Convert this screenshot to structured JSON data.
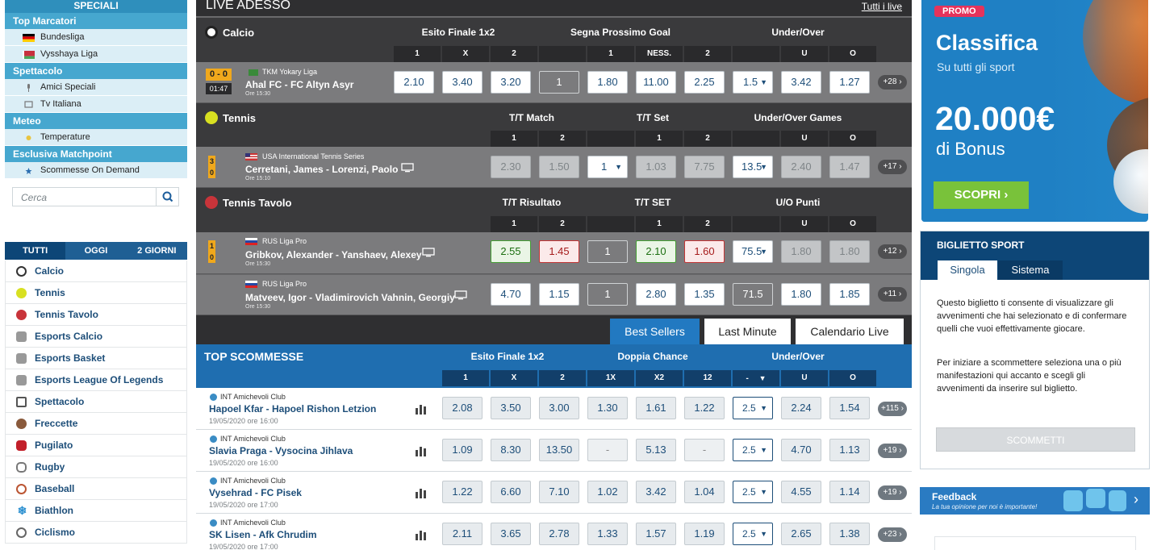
{
  "left": {
    "speciali": "SPECIALI",
    "cats": [
      {
        "label": "Top Marcatori",
        "subs": [
          "Bundesliga",
          "Vysshaya Liga"
        ]
      },
      {
        "label": "Spettacolo",
        "subs": [
          "Amici Speciali",
          "Tv Italiana"
        ]
      },
      {
        "label": "Meteo",
        "subs": [
          "Temperature"
        ]
      },
      {
        "label": "Esclusiva Matchpoint",
        "subs": [
          "Scommesse On Demand"
        ]
      }
    ],
    "search_placeholder": "Cerca",
    "tabs": [
      "TUTTI",
      "OGGI",
      "2 GIORNI"
    ],
    "sports": [
      "Calcio",
      "Tennis",
      "Tennis Tavolo",
      "Esports Calcio",
      "Esports Basket",
      "Esports League Of Legends",
      "Spettacolo",
      "Freccette",
      "Pugilato",
      "Rugby",
      "Baseball",
      "Biathlon",
      "Ciclismo"
    ]
  },
  "live": {
    "title": "LIVE ADESSO",
    "all_link": "Tutti i live",
    "calcio": {
      "name": "Calcio",
      "groups": [
        "Esito Finale 1x2",
        "Segna Prossimo Goal",
        "Under/Over"
      ],
      "cols": [
        "1",
        "X",
        "2",
        "1",
        "NESS.",
        "2",
        "U",
        "O"
      ],
      "match": {
        "score": "0 - 0",
        "clock": "01:47",
        "league": "TKM Yokary Liga",
        "teams": "Ahal FC - FC Altyn Asyr",
        "time": "Ore 15:30",
        "odds": [
          "2.10",
          "3.40",
          "3.20",
          "1",
          "1.80",
          "11.00",
          "2.25",
          "1.5",
          "3.42",
          "1.27"
        ],
        "more": "+28"
      }
    },
    "tennis": {
      "name": "Tennis",
      "groups": [
        "T/T Match",
        "T/T Set",
        "Under/Over Games"
      ],
      "cols": [
        "1",
        "2",
        "1",
        "2",
        "U",
        "O"
      ],
      "match": {
        "s1": "3",
        "s2": "0",
        "league": "USA International Tennis Series",
        "teams": "Cerretani, James - Lorenzi, Paolo",
        "time": "Ore 15:10",
        "odds": [
          "2.30",
          "1.50",
          "1",
          "1.03",
          "7.75",
          "13.5",
          "2.40",
          "1.47"
        ],
        "more": "+17"
      }
    },
    "tavolo": {
      "name": "Tennis Tavolo",
      "groups": [
        "T/T Risultato",
        "T/T SET",
        "U/O Punti"
      ],
      "cols": [
        "1",
        "2",
        "1",
        "2",
        "U",
        "O"
      ],
      "matches": [
        {
          "s1": "1",
          "s2": "0",
          "league": "RUS Liga Pro",
          "teams": "Gribkov, Alexander - Yanshaev, Alexey",
          "time": "Ore 15:30",
          "odds": [
            "2.55",
            "1.45",
            "1",
            "2.10",
            "1.60",
            "75.5",
            "1.80",
            "1.80"
          ],
          "more": "+12"
        },
        {
          "league": "RUS Liga Pro",
          "teams": "Matveev, Igor - Vladimirovich Vahnin, Georgiy",
          "time": "Ore 15:30",
          "odds": [
            "4.70",
            "1.15",
            "1",
            "2.80",
            "1.35",
            "71.5",
            "1.80",
            "1.85"
          ],
          "more": "+11"
        }
      ]
    }
  },
  "tabs": [
    "Best Sellers",
    "Last Minute",
    "Calendario Live"
  ],
  "top": {
    "title": "TOP SCOMMESSE",
    "groups": [
      "Esito Finale 1x2",
      "Doppia Chance",
      "Under/Over"
    ],
    "cols": [
      "1",
      "X",
      "2",
      "1X",
      "X2",
      "12",
      "-",
      "U",
      "O"
    ],
    "rows": [
      {
        "league": "INT Amichevoli Club",
        "teams": "Hapoel Kfar - Hapoel Rishon Letzion",
        "time": "19/05/2020 ore 16:00",
        "odds": [
          "2.08",
          "3.50",
          "3.00",
          "1.30",
          "1.61",
          "1.22",
          "2.5",
          "2.24",
          "1.54"
        ],
        "more": "+115"
      },
      {
        "league": "INT Amichevoli Club",
        "teams": "Slavia Praga - Vysocina Jihlava",
        "time": "19/05/2020 ore 16:00",
        "odds": [
          "1.09",
          "8.30",
          "13.50",
          "-",
          "5.13",
          "-",
          "2.5",
          "4.70",
          "1.13"
        ],
        "more": "+19"
      },
      {
        "league": "INT Amichevoli Club",
        "teams": "Vysehrad - FC Pisek",
        "time": "19/05/2020 ore 17:00",
        "odds": [
          "1.22",
          "6.60",
          "7.10",
          "1.02",
          "3.42",
          "1.04",
          "2.5",
          "4.55",
          "1.14"
        ],
        "more": "+19"
      },
      {
        "league": "INT Amichevoli Club",
        "teams": "SK Lisen - Afk Chrudim",
        "time": "19/05/2020 ore 17:00",
        "odds": [
          "2.11",
          "3.65",
          "2.78",
          "1.33",
          "1.57",
          "1.19",
          "2.5",
          "2.65",
          "1.38"
        ],
        "more": "+23"
      }
    ]
  },
  "promo": {
    "badge": "PROMO",
    "title": "Classifica",
    "subtitle": "Su tutti gli sport",
    "amount": "20.000€",
    "bonus": "di Bonus",
    "cta": "SCOPRI"
  },
  "slip": {
    "title": "BIGLIETTO SPORT",
    "tabs": [
      "Singola",
      "Sistema"
    ],
    "p1": "Questo biglietto ti consente di visualizzare gli avvenimenti che hai selezionato e di confermare quelli che vuoi effettivamente giocare.",
    "p2": "Per iniziare a scommettere seleziona una o più manifestazioni qui accanto e scegli gli avvenimenti da inserire sul biglietto.",
    "button": "SCOMMETTI"
  },
  "feedback": {
    "title": "Feedback",
    "subtitle": "La tua opinione per noi è importante!"
  }
}
